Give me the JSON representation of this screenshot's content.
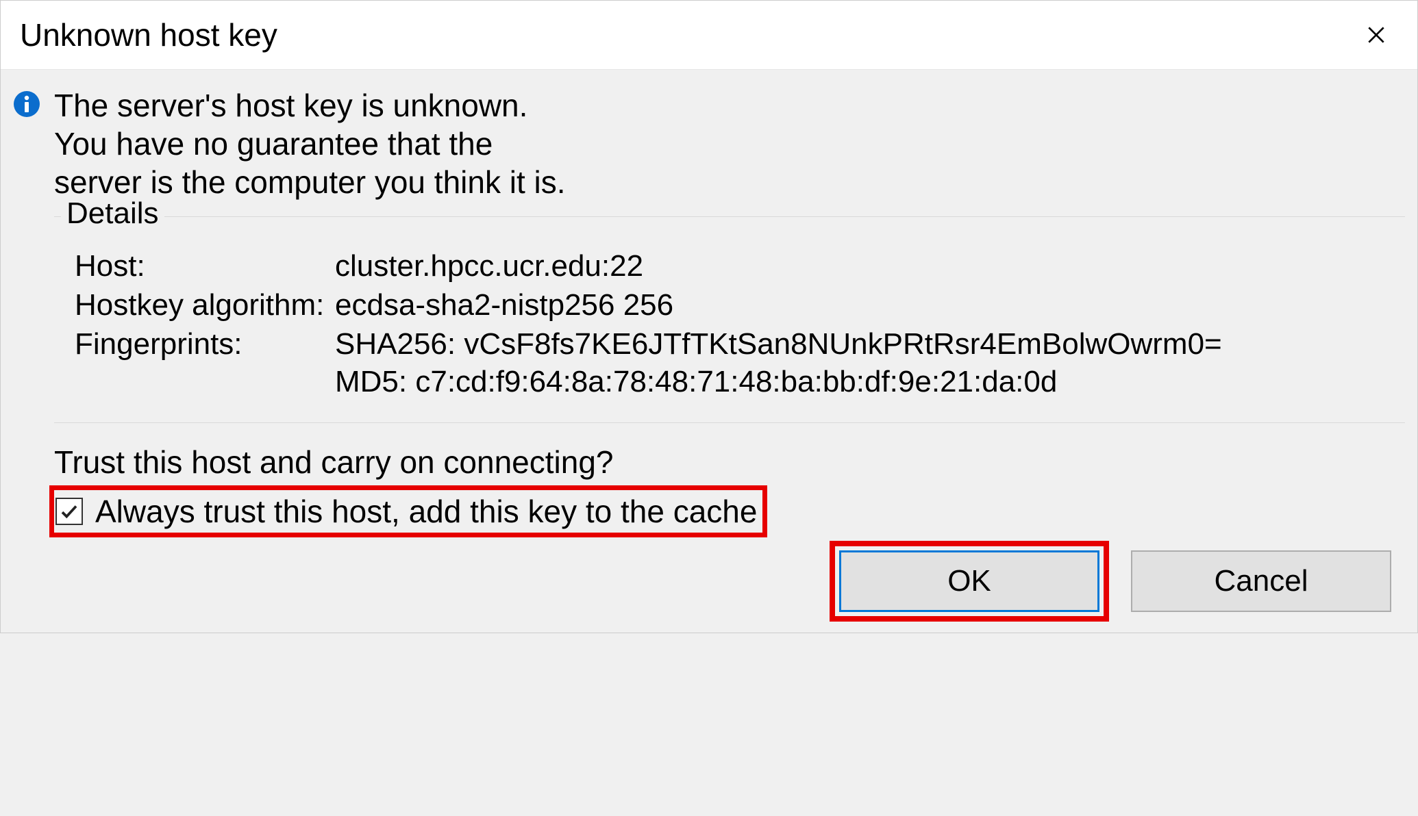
{
  "dialog": {
    "title": "Unknown host key",
    "message": "The server's host key is unknown. You have no guarantee that the server is the computer you think it is.",
    "details_legend": "Details",
    "host_label": "Host:",
    "host_value": "cluster.hpcc.ucr.edu:22",
    "algo_label": "Hostkey algorithm:",
    "algo_value": "ecdsa-sha2-nistp256 256",
    "fingerprints_label": "Fingerprints:",
    "fingerprints_sha256": "SHA256: vCsF8fs7KE6JTfTKtSan8NUnkPRtRsr4EmBolwOwrm0=",
    "fingerprints_md5": "MD5: c7:cd:f9:64:8a:78:48:71:48:ba:bb:df:9e:21:da:0d",
    "trust_prompt": "Trust this host and carry on connecting?",
    "always_trust_label": "Always trust this host, add this key to the cache",
    "always_trust_checked": true,
    "ok_label": "OK",
    "cancel_label": "Cancel"
  }
}
